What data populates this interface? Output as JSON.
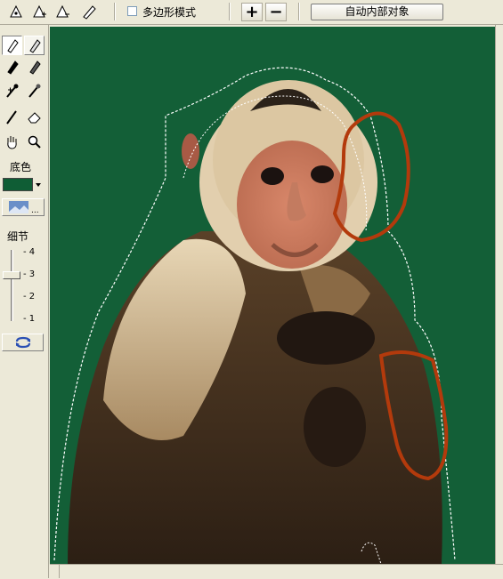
{
  "toolbar": {
    "polygon_mode_label": "多边形模式",
    "auto_inner_button": "自动内部对象",
    "plus_label": "+",
    "minus_label": "−"
  },
  "panel": {
    "bg_color_label": "底色",
    "bg_color_value": "#0f5d35",
    "detail_label": "细节",
    "detail_ticks": [
      "4",
      "3",
      "2",
      "1"
    ],
    "detail_level": 3
  },
  "canvas": {
    "background": "#135f37",
    "image_subject": "monkey-photo"
  }
}
